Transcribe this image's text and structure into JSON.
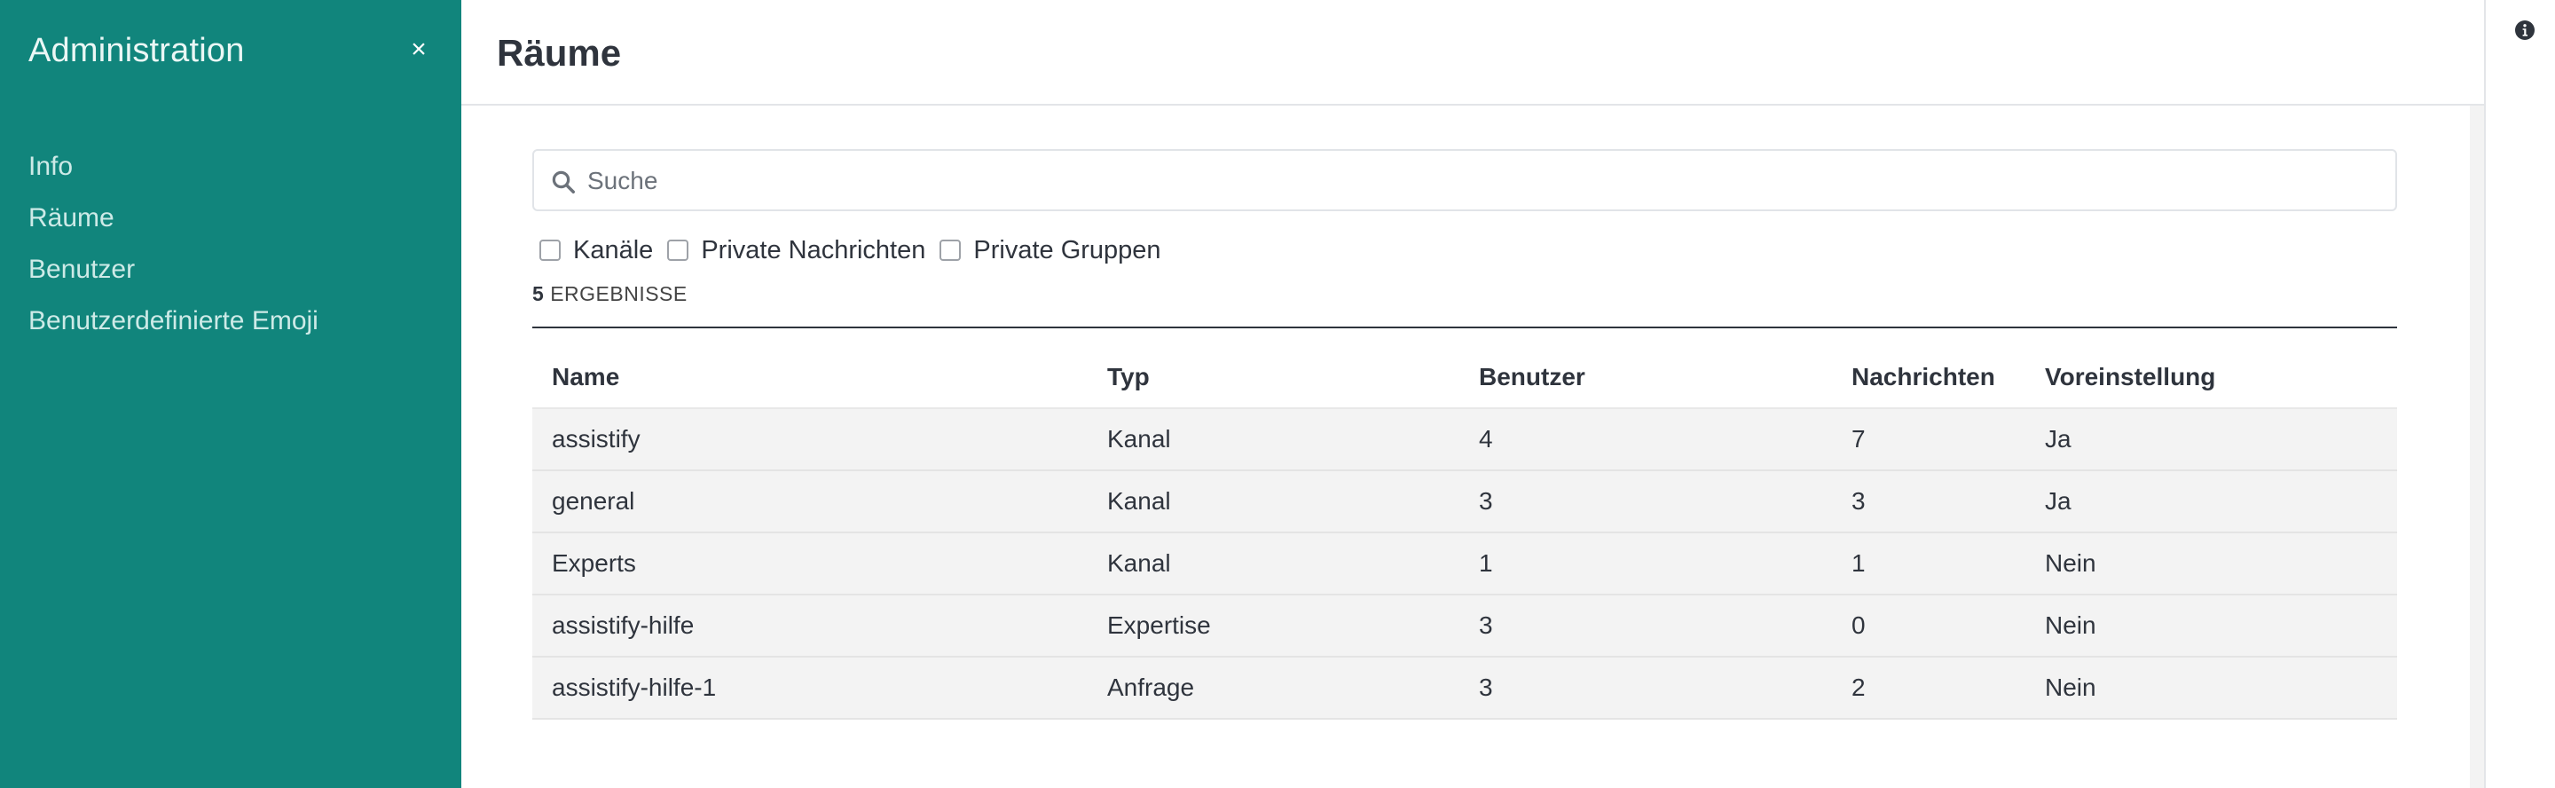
{
  "sidebar": {
    "title": "Administration",
    "close_glyph": "×",
    "items": [
      {
        "label": "Info"
      },
      {
        "label": "Räume"
      },
      {
        "label": "Benutzer"
      },
      {
        "label": "Benutzerdefinierte Emoji"
      }
    ]
  },
  "main": {
    "title": "Räume",
    "search": {
      "placeholder": "Suche",
      "value": "",
      "icon": "search-icon"
    },
    "filters": [
      {
        "label": "Kanäle",
        "checked": false
      },
      {
        "label": "Private Nachrichten",
        "checked": false
      },
      {
        "label": "Private Gruppen",
        "checked": false
      }
    ],
    "results": {
      "count": "5",
      "label": "ERGEBNISSE"
    },
    "table": {
      "headers": [
        "Name",
        "Typ",
        "Benutzer",
        "Nachrichten",
        "Voreinstellung"
      ],
      "rows": [
        [
          "assistify",
          "Kanal",
          "4",
          "7",
          "Ja"
        ],
        [
          "general",
          "Kanal",
          "3",
          "3",
          "Ja"
        ],
        [
          "Experts",
          "Kanal",
          "1",
          "1",
          "Nein"
        ],
        [
          "assistify-hilfe",
          "Expertise",
          "3",
          "0",
          "Nein"
        ],
        [
          "assistify-hilfe-1",
          "Anfrage",
          "3",
          "2",
          "Nein"
        ]
      ]
    }
  },
  "right_rail": {
    "icon": "info-icon"
  },
  "colors": {
    "sidebar_bg": "#11857c",
    "row_bg": "#f3f3f3",
    "text": "#2f343d"
  }
}
